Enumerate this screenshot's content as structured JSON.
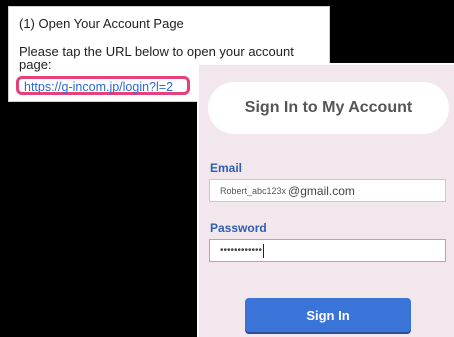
{
  "instructions": {
    "title": "(1) Open Your Account Page",
    "body": "Please tap the URL below to open your account page:",
    "url": "https://g-incom.jp/login?l=2"
  },
  "signin": {
    "title": "Sign In to My Account",
    "email_label": "Email",
    "email_user": "Robert_abc123x",
    "email_domain": "@gmail.com",
    "password_label": "Password",
    "password_masked": "••••••••••••",
    "button_label": "Sign In"
  },
  "colors": {
    "link": "#2a6ad8",
    "highlight": "#e8407a",
    "card_bg": "#f2e7ec",
    "label": "#2e5fb5",
    "focus_border": "#e0a63c",
    "button": "#3b74d9"
  }
}
